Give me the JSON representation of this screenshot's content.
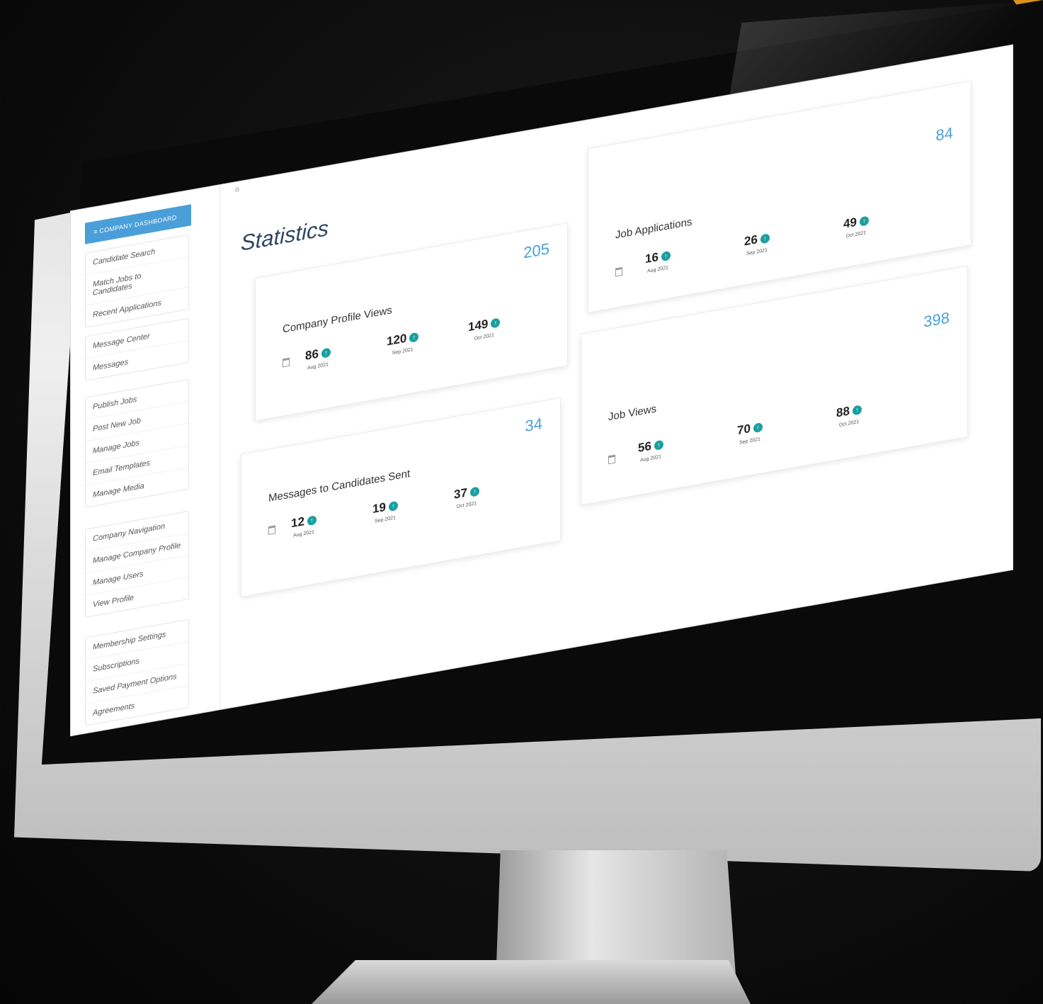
{
  "sidebar": {
    "dashboard_label": "≡ COMPANY DASHBOARD",
    "groups": [
      {
        "items": [
          "Candidate Search",
          "Match Jobs to Candidates",
          "Recent Applications"
        ]
      },
      {
        "items": [
          "Message Center",
          "Messages"
        ]
      },
      {
        "items": [
          "Publish Jobs",
          "Post New Job",
          "Manage Jobs",
          "Email Templates",
          "Manage Media"
        ]
      },
      {
        "items": [
          "Company Navigation",
          "Manage Company Profile",
          "Manage Users",
          "View Profile"
        ]
      },
      {
        "items": [
          "Membership Settings",
          "Subscriptions",
          "Saved Payment Options",
          "Agreements"
        ]
      }
    ]
  },
  "main": {
    "home_icon": "home-icon",
    "title": "Statistics"
  },
  "cards": [
    {
      "title": "Company Profile Views",
      "total": "205",
      "stats": [
        {
          "value": "86",
          "label": "Aug 2021"
        },
        {
          "value": "120",
          "label": "Sep 2021"
        },
        {
          "value": "149",
          "label": "Oct 2021"
        }
      ]
    },
    {
      "title": "Job Applications",
      "total": "84",
      "stats": [
        {
          "value": "16",
          "label": "Aug 2021"
        },
        {
          "value": "26",
          "label": "Sep 2021"
        },
        {
          "value": "49",
          "label": "Oct 2021"
        }
      ]
    },
    {
      "title": "Messages to Candidates Sent",
      "total": "34",
      "stats": [
        {
          "value": "12",
          "label": "Aug 2021"
        },
        {
          "value": "19",
          "label": "Sep 2021"
        },
        {
          "value": "37",
          "label": "Oct 2021"
        }
      ]
    },
    {
      "title": "Job Views",
      "total": "398",
      "stats": [
        {
          "value": "56",
          "label": "Aug 2021"
        },
        {
          "value": "70",
          "label": "Sep 2021"
        },
        {
          "value": "88",
          "label": "Oct 2021"
        }
      ]
    }
  ],
  "colors": {
    "accent": "#4a9fd8",
    "up_icon": "#1a9fa0",
    "title": "#2f4660"
  }
}
